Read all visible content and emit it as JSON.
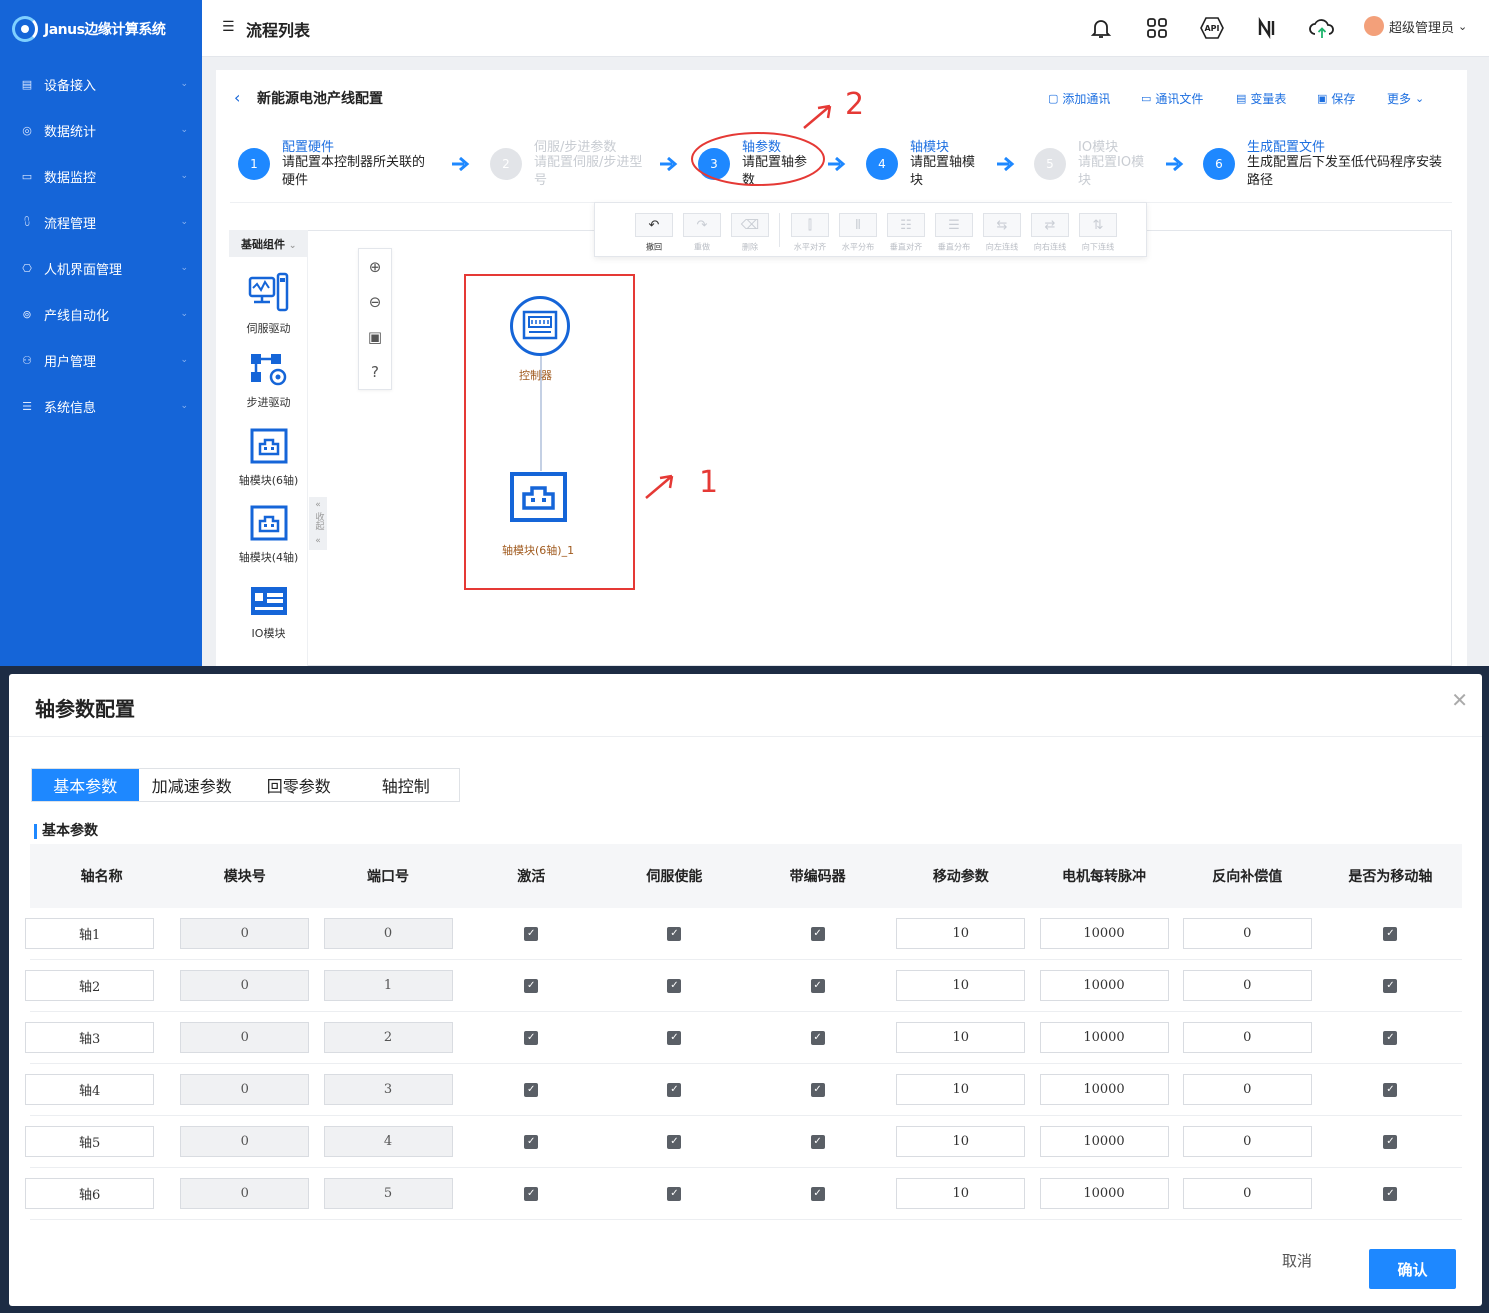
{
  "app": {
    "name": "Janus边缘计算系统"
  },
  "sidebar": {
    "items": [
      {
        "label": "设备接入",
        "icon": "device-icon"
      },
      {
        "label": "数据统计",
        "icon": "stats-icon"
      },
      {
        "label": "数据监控",
        "icon": "monitor-icon"
      },
      {
        "label": "流程管理",
        "icon": "flow-icon"
      },
      {
        "label": "人机界面管理",
        "icon": "hmi-icon"
      },
      {
        "label": "产线自动化",
        "icon": "automation-icon"
      },
      {
        "label": "用户管理",
        "icon": "user-icon"
      },
      {
        "label": "系统信息",
        "icon": "settings-icon"
      }
    ]
  },
  "topbar": {
    "title": "流程列表",
    "user": "超级管理员",
    "api_label": "API"
  },
  "panel": {
    "title": "新能源电池产线配置",
    "actions": [
      "添加通讯",
      "通讯文件",
      "变量表",
      "保存",
      "更多"
    ]
  },
  "steps": [
    {
      "num": "1",
      "title": "配置硬件",
      "desc": "请配置本控制器所关联的硬件",
      "state": "active"
    },
    {
      "num": "2",
      "title": "伺服/步进参数",
      "desc": "请配置伺服/步进型号",
      "state": "disabled"
    },
    {
      "num": "3",
      "title": "轴参数",
      "desc": "请配置轴参数",
      "state": "active"
    },
    {
      "num": "4",
      "title": "轴模块",
      "desc": "请配置轴模块",
      "state": "active"
    },
    {
      "num": "5",
      "title": "IO模块",
      "desc": "请配置IO模块",
      "state": "disabled"
    },
    {
      "num": "6",
      "title": "生成配置文件",
      "desc": "生成配置后下发至低代码程序安装路径",
      "state": "active"
    }
  ],
  "toolbar": {
    "items": [
      "撤回",
      "重做",
      "删除",
      "水平对齐",
      "水平分布",
      "垂直对齐",
      "垂直分布",
      "向左连线",
      "向右连线",
      "向下连线"
    ]
  },
  "library": {
    "header": "基础组件",
    "collapse": "收起",
    "components": [
      "伺服驱动",
      "步进驱动",
      "轴模块(6轴)",
      "轴模块(4轴)",
      "IO模块"
    ]
  },
  "diagram": {
    "nodes": [
      "控制器",
      "轴模块(6轴)_1"
    ]
  },
  "annotations": {
    "label1": "1",
    "label2": "2"
  },
  "dialog": {
    "title": "轴参数配置",
    "tabs": [
      "基本参数",
      "加减速参数",
      "回零参数",
      "轴控制"
    ],
    "section": "基本参数",
    "columns": [
      "轴名称",
      "模块号",
      "端口号",
      "激活",
      "伺服使能",
      "带编码器",
      "移动参数",
      "电机每转脉冲",
      "反向补偿值",
      "是否为移动轴"
    ],
    "rows": [
      {
        "name": "轴1",
        "module": "0",
        "port": "0",
        "move": "10",
        "pulse": "10000",
        "comp": "0"
      },
      {
        "name": "轴2",
        "module": "0",
        "port": "1",
        "move": "10",
        "pulse": "10000",
        "comp": "0"
      },
      {
        "name": "轴3",
        "module": "0",
        "port": "2",
        "move": "10",
        "pulse": "10000",
        "comp": "0"
      },
      {
        "name": "轴4",
        "module": "0",
        "port": "3",
        "move": "10",
        "pulse": "10000",
        "comp": "0"
      },
      {
        "name": "轴5",
        "module": "0",
        "port": "4",
        "move": "10",
        "pulse": "10000",
        "comp": "0"
      },
      {
        "name": "轴6",
        "module": "0",
        "port": "5",
        "move": "10",
        "pulse": "10000",
        "comp": "0"
      }
    ],
    "cancel": "取消",
    "confirm": "确认"
  },
  "colors": {
    "primary": "#1e88ff",
    "sidebar": "#1565d8",
    "annotation": "#e53935"
  }
}
